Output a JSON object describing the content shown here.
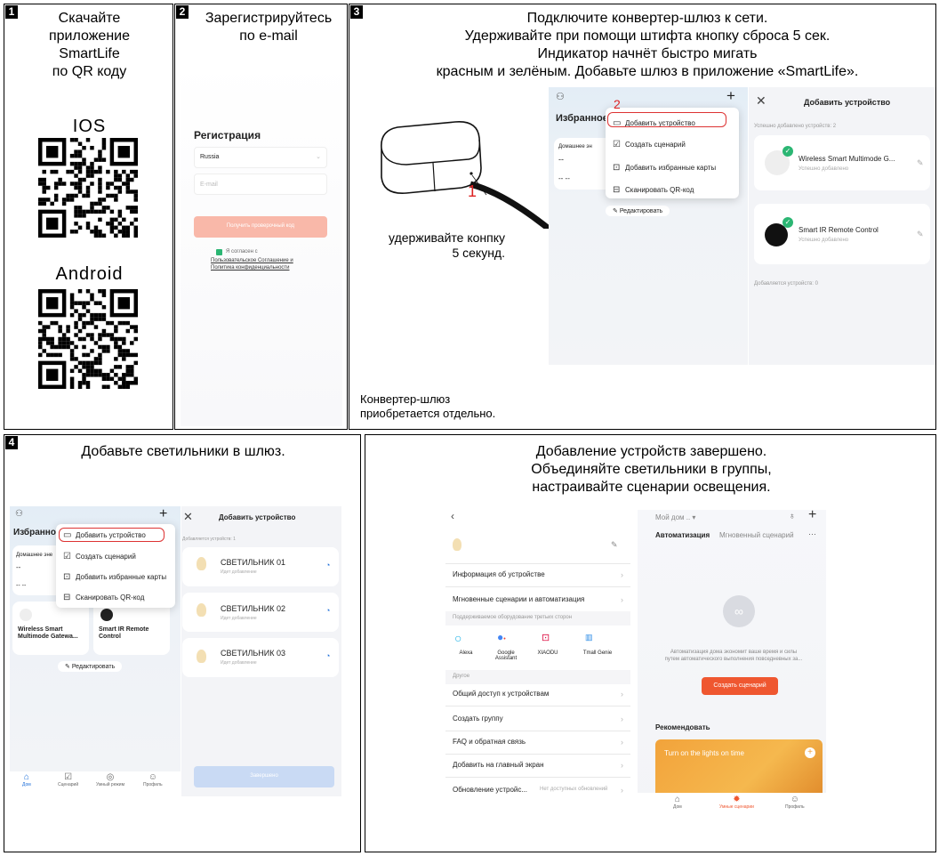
{
  "p1": {
    "num": "1",
    "title": "Скачайте\nприложение\nSmartLife\nпо QR коду",
    "ios": "IOS",
    "android": "Android"
  },
  "p2": {
    "num": "2",
    "title": "Зарегистрируйтесь\nпо e-mail",
    "reg": "Регистрация",
    "country": "Russia",
    "email": "E-mail",
    "button": "Получить проверочный код",
    "agree": "Я согласен с",
    "terms": "Пользовательское Соглашение и",
    "privacy": "Политика конфиденциальности"
  },
  "p3": {
    "num": "3",
    "title": "Подключите конвертер-шлюз к сети.\nУдерживайте при помощи штифта кнопку сброса 5 сек.\nИндикатор начнёт быстро мигать\nкрасным и зелёным. Добавьте шлюз в приложение «SmartLife».",
    "mark1": "1",
    "mark2": "2",
    "hold": "удерживайте конпку\n5 секунд.",
    "note": "Конвертер-шлюз\nприобретается отдельно.",
    "fav": "Избранное",
    "home_energy": "Домашнее эн",
    "dash": "--",
    "dash2": "-- --",
    "menu": [
      "Добавить устройство",
      "Создать сценарий",
      "Добавить избранные карты",
      "Сканировать QR-код"
    ],
    "edit": "Редактировать",
    "add_title": "Добавить устройство",
    "added": "Успешно добавлено устройств: 2",
    "dev1": "Wireless Smart Multimode G...",
    "dev2": "Smart IR Remote Control",
    "ok": "Успешно добавлено",
    "adding": "Добавляется устройств: 0"
  },
  "p4": {
    "num": "4",
    "title": "Добавьте светильники в шлюз.",
    "fav": "Избранное",
    "home_energy": "Домашнее эне",
    "dash": "--",
    "dash2": "-- --",
    "menu": [
      "Добавить устройство",
      "Создать сценарий",
      "Добавить избранные карты",
      "Сканировать QR-код"
    ],
    "gw": "Wireless Smart\nMultimode Gatewa...",
    "ir": "Smart IR Remote\nControl",
    "edit": "Редактировать",
    "add_title": "Добавить устройство",
    "adding": "Добавляется устройств: 1",
    "lamps": [
      "СВЕТИЛЬНИК 01",
      "СВЕТИЛЬНИК 02",
      "СВЕТИЛЬНИК 03"
    ],
    "lamp_sub": "Идет добавление",
    "done": "Завершено",
    "tabs": [
      "Дом",
      "Сценарий",
      "Умный режим",
      "Профиль"
    ]
  },
  "p5": {
    "title": "Добавление устройств завершено.\nОбъединяйте светильники в группы,\nнастраивайте сценарии освещения.",
    "rows1": [
      "Информация об устройстве",
      "Мгновенные сценарии и автоматизация"
    ],
    "third": "Поддерживаемое оборудование третьих сторон",
    "svc": [
      "Alexa",
      "Google\nAssistant",
      "XIAODU",
      "Tmall Genie"
    ],
    "other": "Другое",
    "rows2": [
      "Общий доступ к устройствам",
      "Создать группу",
      "FAQ и обратная связь",
      "Добавить на главный экран",
      "Обновление устройс..."
    ],
    "no_upd": "Нет доступных обновлений",
    "home": "Мой дом ..",
    "tab_auto": "Автоматизация",
    "tab_instant": "Мгновенный сценарий",
    "auto_text": "Автоматизация дома экономит ваше время и силы\nпутем автоматического выполнения повседневных за...",
    "create": "Создать сценарий",
    "recommend": "Рекомендовать",
    "banner": "Turn on the lights on time",
    "tabs": [
      "Дом",
      "Умные сценарии",
      "Профиль"
    ]
  }
}
